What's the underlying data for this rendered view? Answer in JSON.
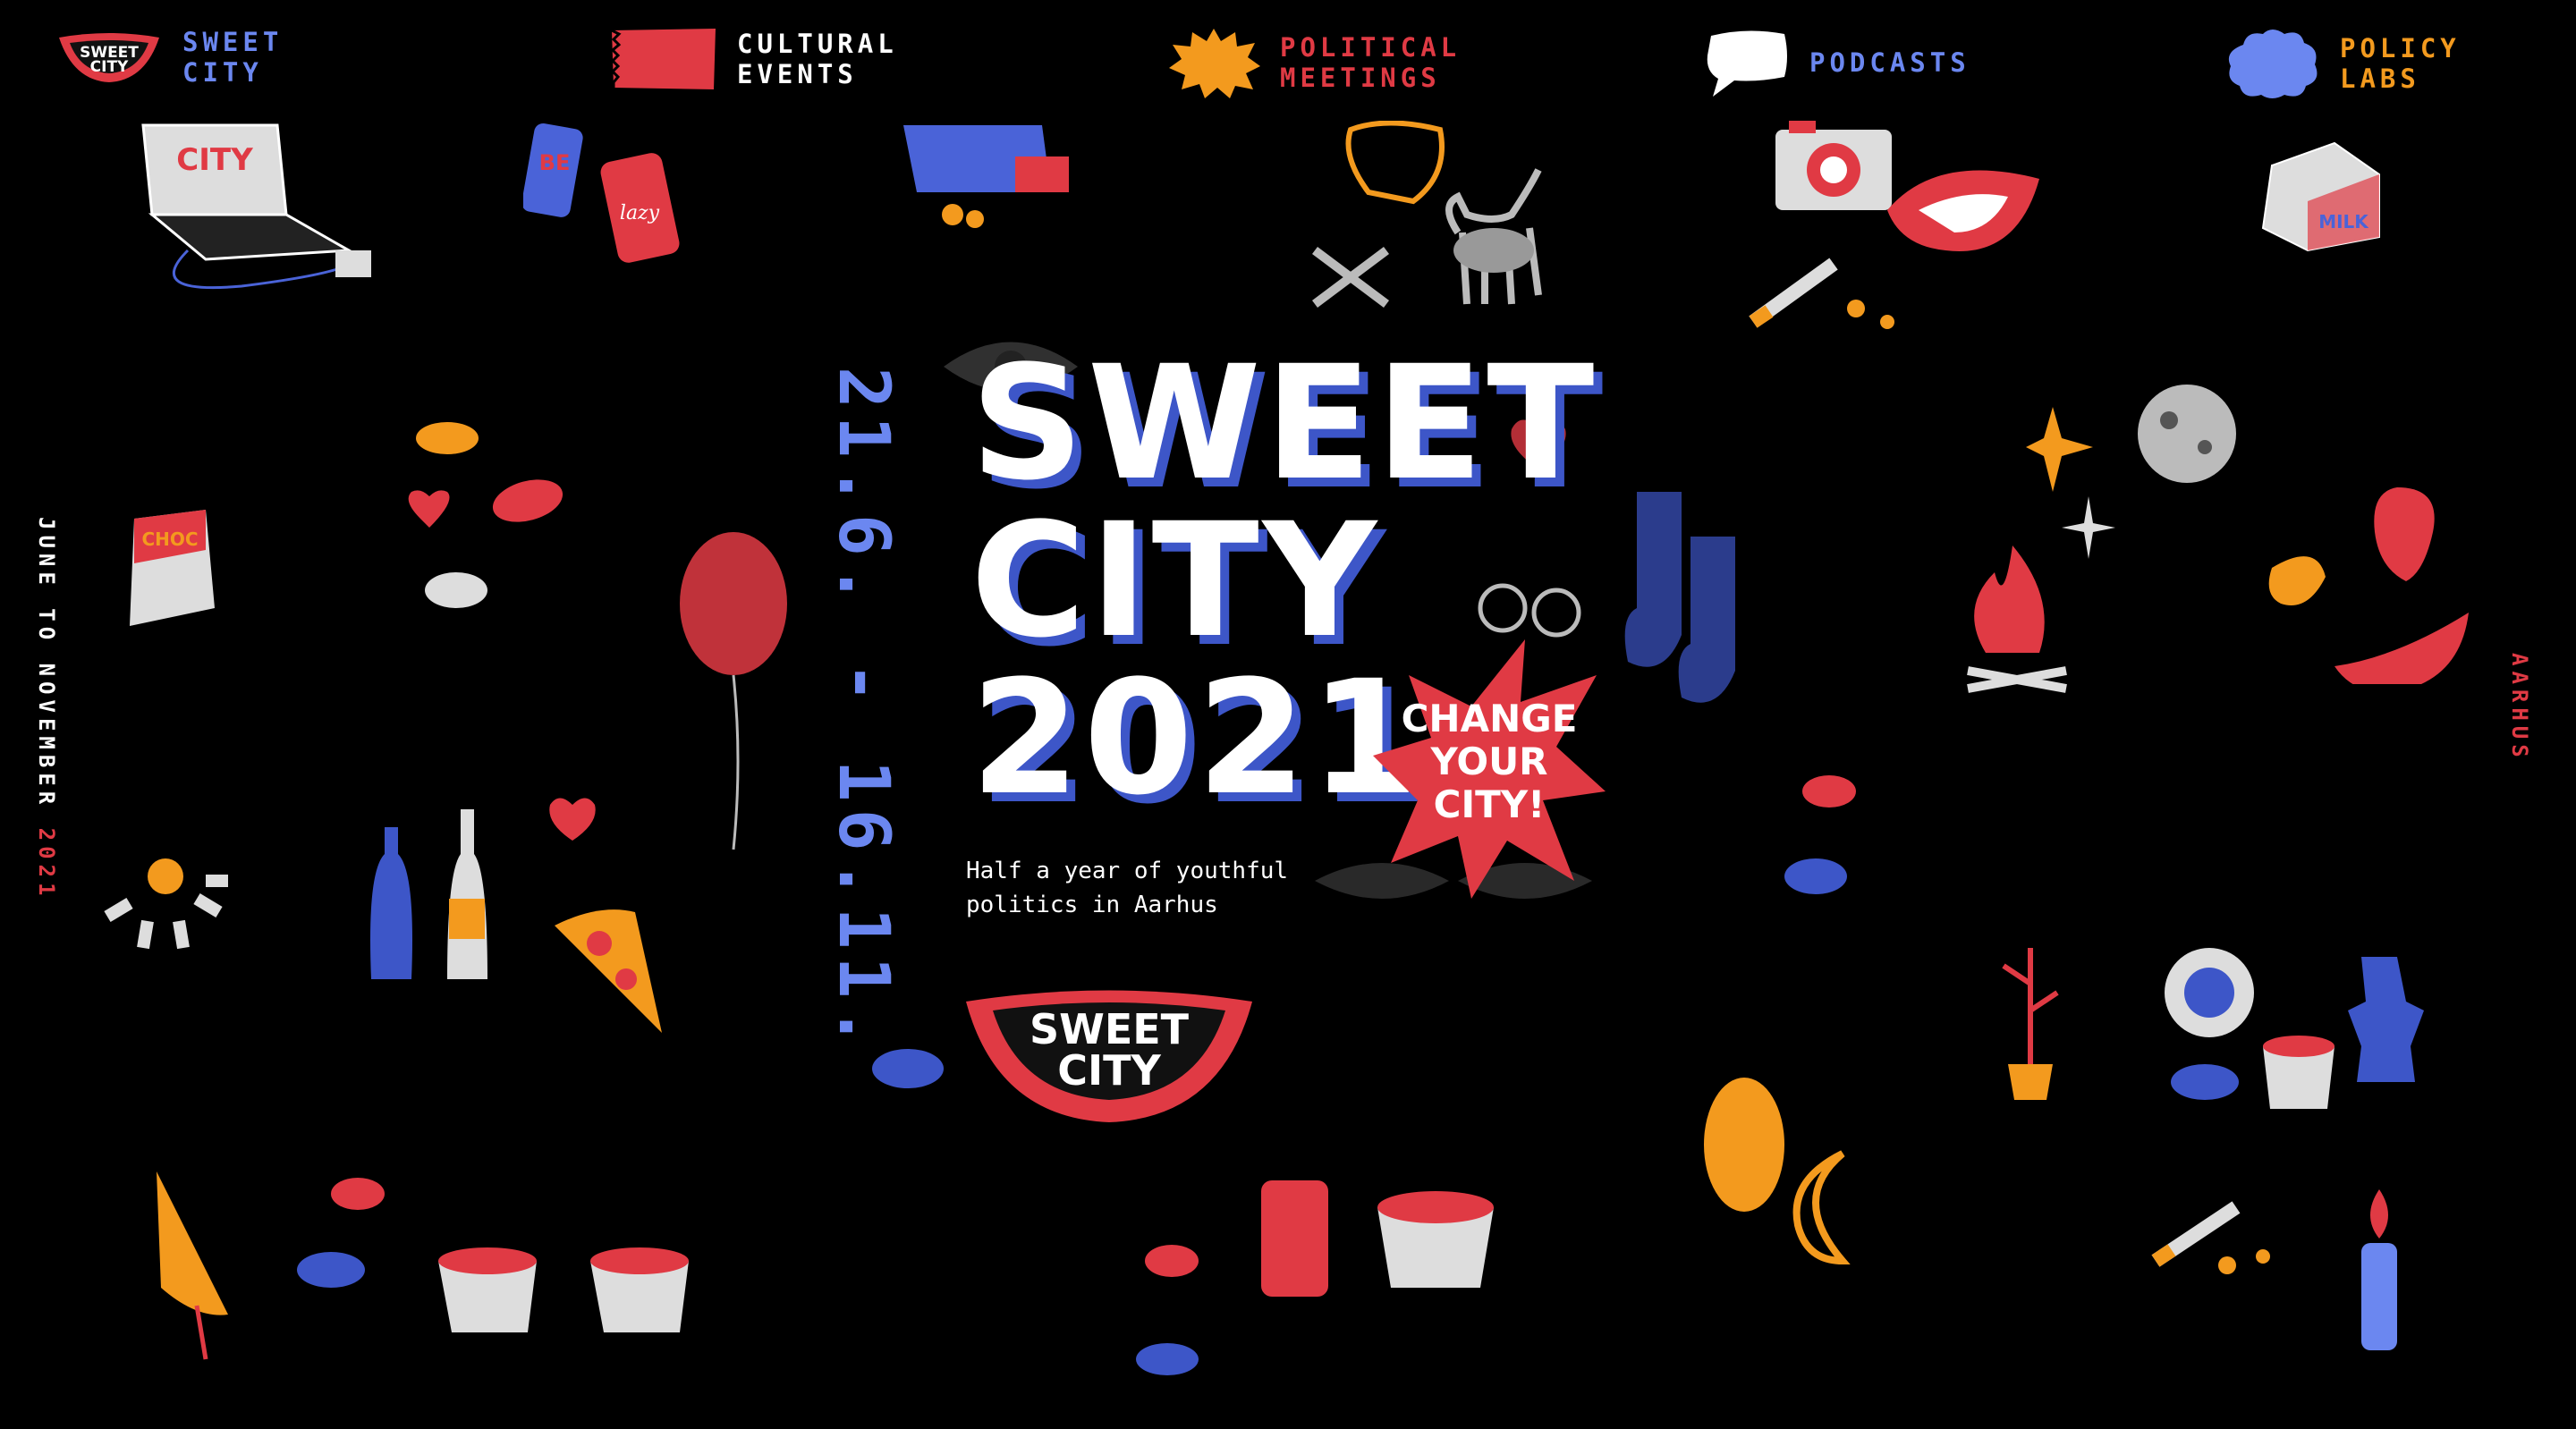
{
  "nav": {
    "brand": {
      "logo_text": [
        "SWEET",
        "CITY"
      ],
      "label": [
        "SWEET",
        "CITY"
      ],
      "color": "#6b87f0"
    },
    "items": [
      {
        "label": [
          "CULTURAL",
          "EVENTS"
        ],
        "color": "#ffffff",
        "icon": "red-ticket-icon"
      },
      {
        "label": [
          "POLITICAL",
          "MEETINGS"
        ],
        "color": "#e03a44",
        "icon": "orange-burst-icon"
      },
      {
        "label": [
          "PODCASTS"
        ],
        "color": "#6b87f0",
        "icon": "speech-bubble-icon"
      },
      {
        "label": [
          "POLICY",
          "LABS"
        ],
        "color": "#f39a1e",
        "icon": "blue-cloud-icon"
      }
    ]
  },
  "side_left": {
    "text": "JUNE TO NOVEMBER",
    "year": "2021"
  },
  "side_right": {
    "text": "AARHUS"
  },
  "hero": {
    "dates": "21.6. - 16.11.",
    "title": [
      "SWEET",
      "CITY",
      "2021"
    ],
    "subtitle": [
      "Half a year of youthful",
      "politics in Aarhus"
    ],
    "burst": [
      "CHANGE",
      "YOUR",
      "CITY!"
    ],
    "logo": [
      "SWEET",
      "CITY"
    ]
  },
  "colors": {
    "red": "#e03a44",
    "blue": "#6b87f0",
    "orange": "#f39a1e",
    "background": "#000000"
  }
}
